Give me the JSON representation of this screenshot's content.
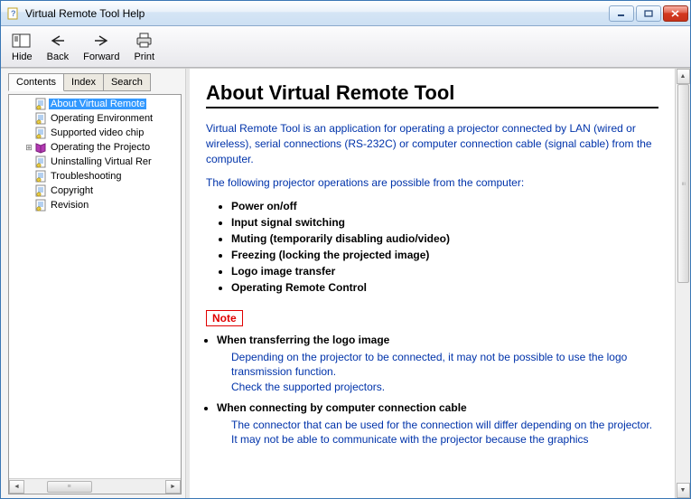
{
  "window": {
    "title": "Virtual Remote Tool Help"
  },
  "toolbar": {
    "hide": "Hide",
    "back": "Back",
    "forward": "Forward",
    "print": "Print"
  },
  "tabs": {
    "contents": "Contents",
    "index": "Index",
    "search": "Search"
  },
  "tree": [
    {
      "label": "About Virtual Remote",
      "selected": true,
      "icon": "doc"
    },
    {
      "label": "Operating Environment",
      "selected": false,
      "icon": "doc"
    },
    {
      "label": "Supported video chip",
      "selected": false,
      "icon": "doc"
    },
    {
      "label": "Operating the Projecto",
      "selected": false,
      "icon": "book",
      "expandable": true
    },
    {
      "label": "Uninstalling Virtual Rer",
      "selected": false,
      "icon": "doc"
    },
    {
      "label": "Troubleshooting",
      "selected": false,
      "icon": "doc"
    },
    {
      "label": "Copyright",
      "selected": false,
      "icon": "doc"
    },
    {
      "label": "Revision",
      "selected": false,
      "icon": "doc"
    }
  ],
  "page": {
    "title": "About Virtual Remote Tool",
    "intro": "Virtual Remote Tool is an application for operating a projector connected by LAN (wired or wireless), serial connections (RS-232C) or computer connection cable (signal cable) from the computer.",
    "lead": "The following projector operations are possible from the computer:",
    "ops": [
      "Power on/off",
      "Input signal switching",
      "Muting (temporarily disabling audio/video)",
      "Freezing (locking the projected image)",
      "Logo image transfer",
      "Operating Remote Control"
    ],
    "note_label": "Note",
    "notes": [
      {
        "head": "When transferring the logo image",
        "body": "Depending on the projector to be connected, it may not be possible to use the logo transmission function.\nCheck the supported projectors."
      },
      {
        "head": "When connecting by computer connection cable",
        "body": "The connector that can be used for the connection will differ depending on the projector.\nIt may not be able to communicate with the projector because the graphics"
      }
    ]
  }
}
